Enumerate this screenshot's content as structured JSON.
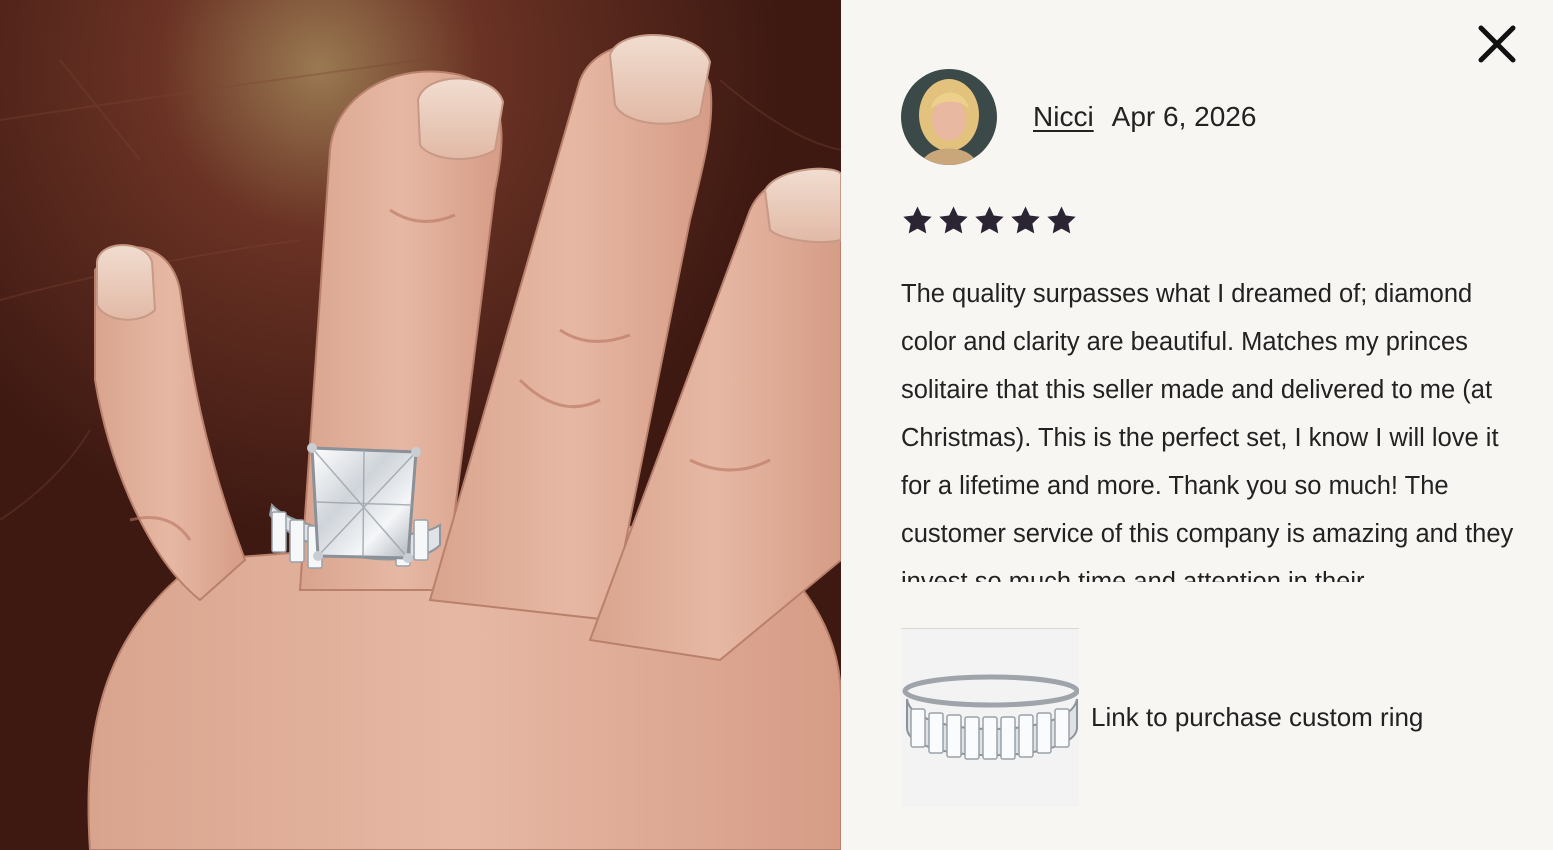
{
  "photo": {
    "alt": "Hand wearing a princess-cut solitaire engagement ring with an emerald-cut eternity band"
  },
  "close": {
    "icon": "close-icon"
  },
  "review": {
    "reviewer_name": "Nicci",
    "date": "Apr 6, 2026",
    "rating": 5,
    "rating_max": 5,
    "star_color": "#2a2433",
    "text": "The quality surpasses what I dreamed of; diamond color and clarity are beautiful. Matches my princes solitaire that this seller made and delivered to me (at Christmas). This is the perfect set, I know I will love it for a lifetime and more. Thank you so much! The customer service of this company is amazing and they invest so much time and attention in their"
  },
  "product": {
    "link_label": "Link to purchase custom ring"
  },
  "colors": {
    "panel_background": "#f8f6f2",
    "text": "#222222"
  }
}
